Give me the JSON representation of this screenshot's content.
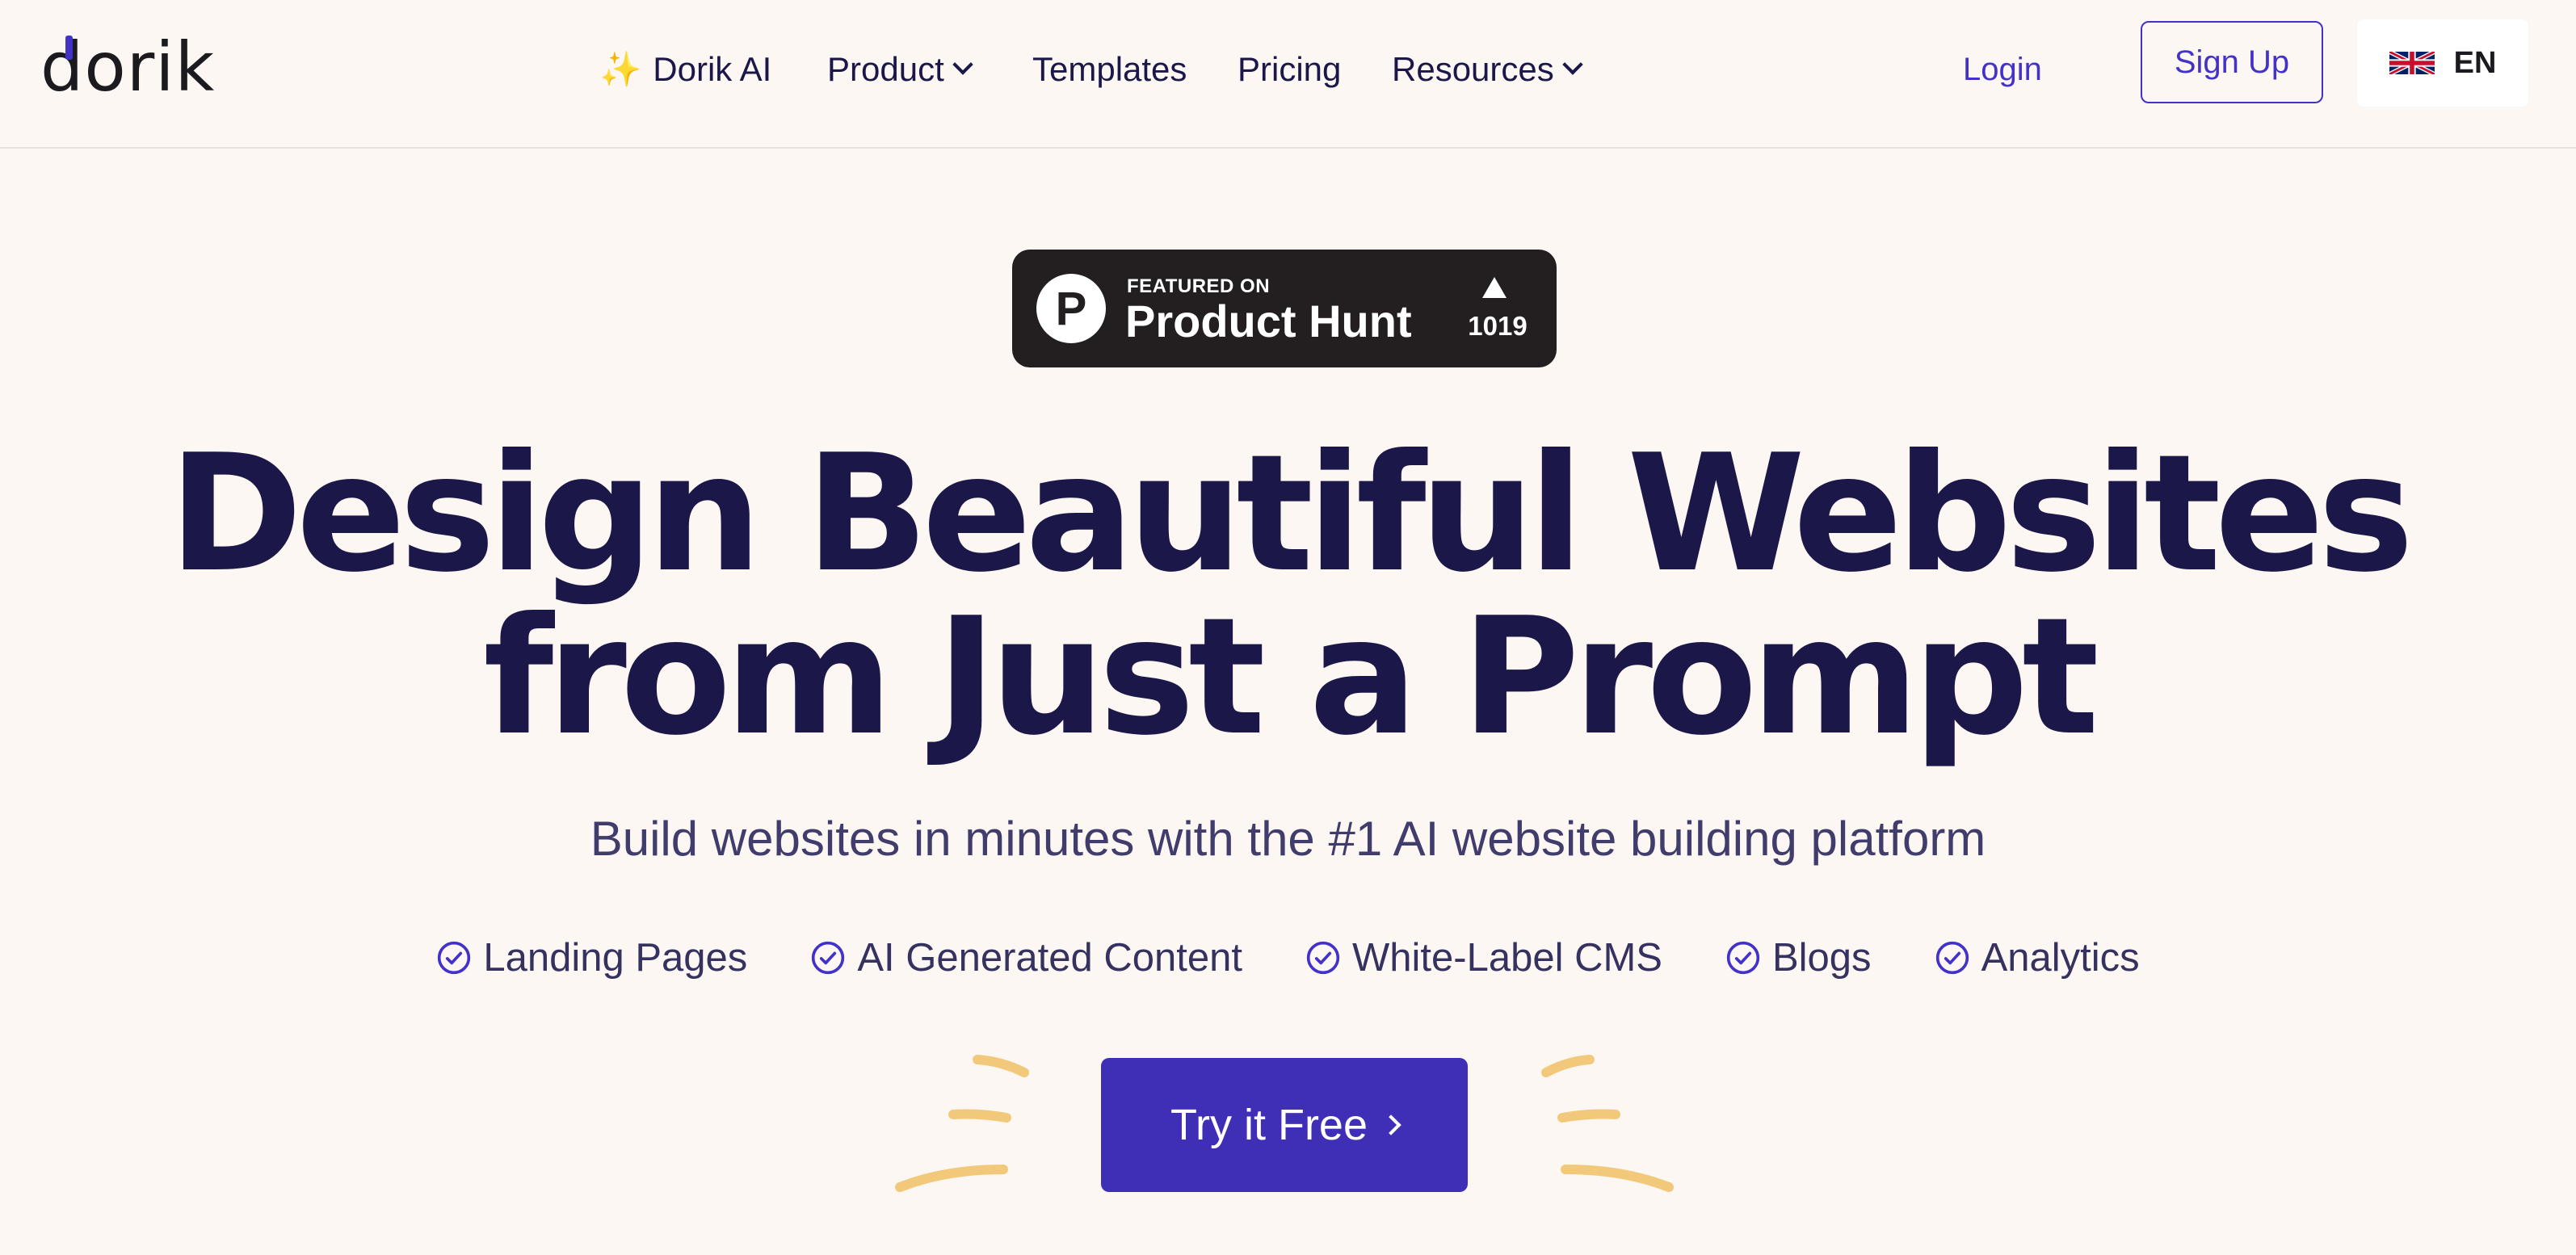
{
  "header": {
    "logo": "dorik",
    "nav": [
      {
        "label": "Dorik AI",
        "icon": "sparkle-icon"
      },
      {
        "label": "Product",
        "has_dropdown": true
      },
      {
        "label": "Templates"
      },
      {
        "label": "Pricing"
      },
      {
        "label": "Resources",
        "has_dropdown": true
      }
    ],
    "login_label": "Login",
    "signup_label": "Sign Up",
    "language": {
      "code": "EN",
      "flag_icon": "uk-flag-icon"
    }
  },
  "hero": {
    "badge": {
      "featured_on": "FEATURED ON",
      "name": "Product Hunt",
      "upvotes": "1019",
      "logo_letter": "P"
    },
    "title_line1": "Design Beautiful Websites",
    "title_line2": "from Just a Prompt",
    "subtitle": "Build websites in minutes with the #1 AI website building platform",
    "features": [
      "Landing Pages",
      "AI Generated Content",
      "White-Label CMS",
      "Blogs",
      "Analytics"
    ],
    "cta_label": "Try it Free"
  },
  "colors": {
    "background": "#fdf7f3",
    "primary": "#3f2fb7",
    "heading": "#1b1849",
    "accent_yellow": "#f2c97a"
  }
}
